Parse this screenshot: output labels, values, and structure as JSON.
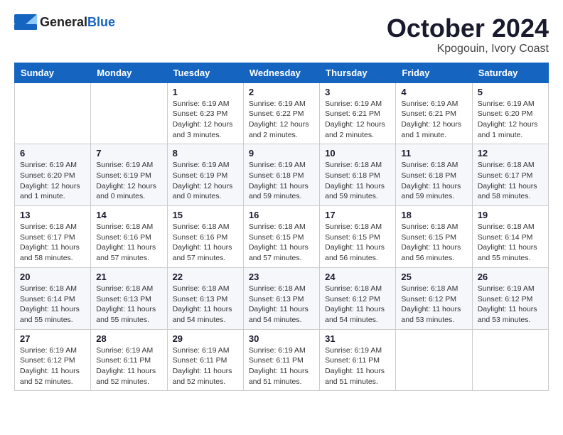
{
  "header": {
    "logo_general": "General",
    "logo_blue": "Blue",
    "title": "October 2024",
    "subtitle": "Kpogouin, Ivory Coast"
  },
  "calendar": {
    "days_of_week": [
      "Sunday",
      "Monday",
      "Tuesday",
      "Wednesday",
      "Thursday",
      "Friday",
      "Saturday"
    ],
    "weeks": [
      [
        {
          "day": "",
          "info": ""
        },
        {
          "day": "",
          "info": ""
        },
        {
          "day": "1",
          "info": "Sunrise: 6:19 AM\nSunset: 6:23 PM\nDaylight: 12 hours\nand 3 minutes."
        },
        {
          "day": "2",
          "info": "Sunrise: 6:19 AM\nSunset: 6:22 PM\nDaylight: 12 hours\nand 2 minutes."
        },
        {
          "day": "3",
          "info": "Sunrise: 6:19 AM\nSunset: 6:21 PM\nDaylight: 12 hours\nand 2 minutes."
        },
        {
          "day": "4",
          "info": "Sunrise: 6:19 AM\nSunset: 6:21 PM\nDaylight: 12 hours\nand 1 minute."
        },
        {
          "day": "5",
          "info": "Sunrise: 6:19 AM\nSunset: 6:20 PM\nDaylight: 12 hours\nand 1 minute."
        }
      ],
      [
        {
          "day": "6",
          "info": "Sunrise: 6:19 AM\nSunset: 6:20 PM\nDaylight: 12 hours\nand 1 minute."
        },
        {
          "day": "7",
          "info": "Sunrise: 6:19 AM\nSunset: 6:19 PM\nDaylight: 12 hours\nand 0 minutes."
        },
        {
          "day": "8",
          "info": "Sunrise: 6:19 AM\nSunset: 6:19 PM\nDaylight: 12 hours\nand 0 minutes."
        },
        {
          "day": "9",
          "info": "Sunrise: 6:19 AM\nSunset: 6:18 PM\nDaylight: 11 hours\nand 59 minutes."
        },
        {
          "day": "10",
          "info": "Sunrise: 6:18 AM\nSunset: 6:18 PM\nDaylight: 11 hours\nand 59 minutes."
        },
        {
          "day": "11",
          "info": "Sunrise: 6:18 AM\nSunset: 6:18 PM\nDaylight: 11 hours\nand 59 minutes."
        },
        {
          "day": "12",
          "info": "Sunrise: 6:18 AM\nSunset: 6:17 PM\nDaylight: 11 hours\nand 58 minutes."
        }
      ],
      [
        {
          "day": "13",
          "info": "Sunrise: 6:18 AM\nSunset: 6:17 PM\nDaylight: 11 hours\nand 58 minutes."
        },
        {
          "day": "14",
          "info": "Sunrise: 6:18 AM\nSunset: 6:16 PM\nDaylight: 11 hours\nand 57 minutes."
        },
        {
          "day": "15",
          "info": "Sunrise: 6:18 AM\nSunset: 6:16 PM\nDaylight: 11 hours\nand 57 minutes."
        },
        {
          "day": "16",
          "info": "Sunrise: 6:18 AM\nSunset: 6:15 PM\nDaylight: 11 hours\nand 57 minutes."
        },
        {
          "day": "17",
          "info": "Sunrise: 6:18 AM\nSunset: 6:15 PM\nDaylight: 11 hours\nand 56 minutes."
        },
        {
          "day": "18",
          "info": "Sunrise: 6:18 AM\nSunset: 6:15 PM\nDaylight: 11 hours\nand 56 minutes."
        },
        {
          "day": "19",
          "info": "Sunrise: 6:18 AM\nSunset: 6:14 PM\nDaylight: 11 hours\nand 55 minutes."
        }
      ],
      [
        {
          "day": "20",
          "info": "Sunrise: 6:18 AM\nSunset: 6:14 PM\nDaylight: 11 hours\nand 55 minutes."
        },
        {
          "day": "21",
          "info": "Sunrise: 6:18 AM\nSunset: 6:13 PM\nDaylight: 11 hours\nand 55 minutes."
        },
        {
          "day": "22",
          "info": "Sunrise: 6:18 AM\nSunset: 6:13 PM\nDaylight: 11 hours\nand 54 minutes."
        },
        {
          "day": "23",
          "info": "Sunrise: 6:18 AM\nSunset: 6:13 PM\nDaylight: 11 hours\nand 54 minutes."
        },
        {
          "day": "24",
          "info": "Sunrise: 6:18 AM\nSunset: 6:12 PM\nDaylight: 11 hours\nand 54 minutes."
        },
        {
          "day": "25",
          "info": "Sunrise: 6:18 AM\nSunset: 6:12 PM\nDaylight: 11 hours\nand 53 minutes."
        },
        {
          "day": "26",
          "info": "Sunrise: 6:19 AM\nSunset: 6:12 PM\nDaylight: 11 hours\nand 53 minutes."
        }
      ],
      [
        {
          "day": "27",
          "info": "Sunrise: 6:19 AM\nSunset: 6:12 PM\nDaylight: 11 hours\nand 52 minutes."
        },
        {
          "day": "28",
          "info": "Sunrise: 6:19 AM\nSunset: 6:11 PM\nDaylight: 11 hours\nand 52 minutes."
        },
        {
          "day": "29",
          "info": "Sunrise: 6:19 AM\nSunset: 6:11 PM\nDaylight: 11 hours\nand 52 minutes."
        },
        {
          "day": "30",
          "info": "Sunrise: 6:19 AM\nSunset: 6:11 PM\nDaylight: 11 hours\nand 51 minutes."
        },
        {
          "day": "31",
          "info": "Sunrise: 6:19 AM\nSunset: 6:11 PM\nDaylight: 11 hours\nand 51 minutes."
        },
        {
          "day": "",
          "info": ""
        },
        {
          "day": "",
          "info": ""
        }
      ]
    ]
  }
}
